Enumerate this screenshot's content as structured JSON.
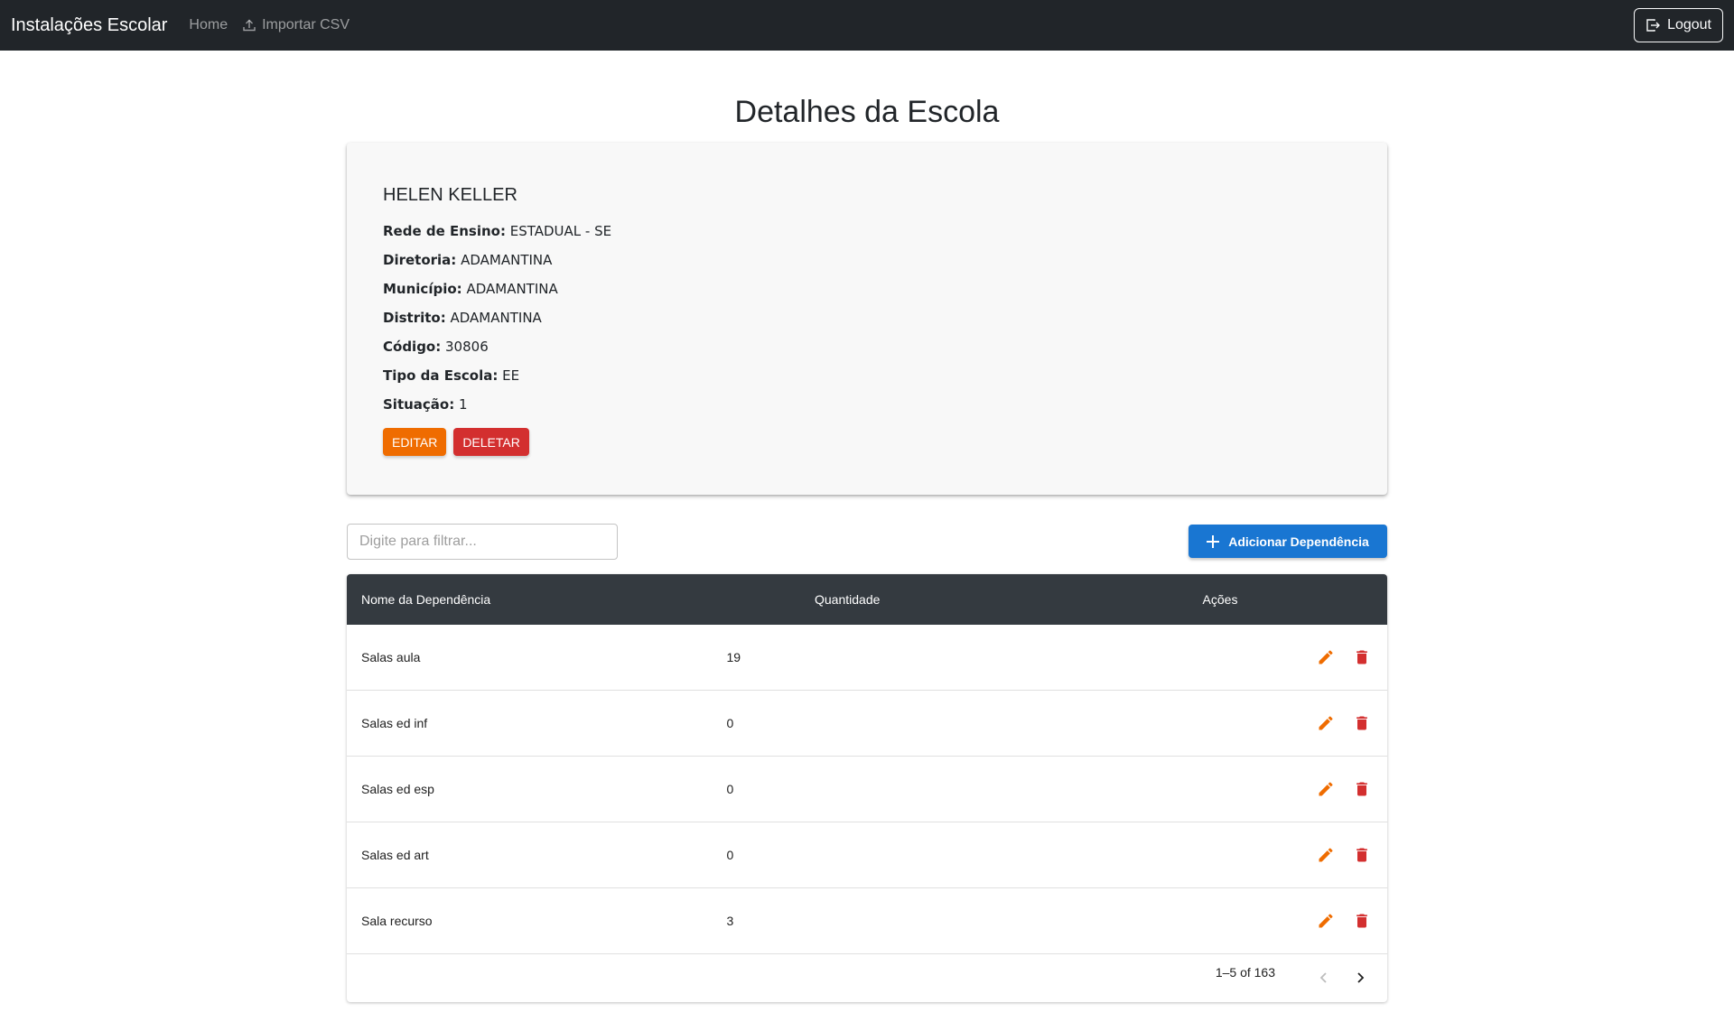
{
  "navbar": {
    "brand": "Instalações Escolar",
    "links": [
      {
        "label": "Home"
      },
      {
        "label": "Importar CSV",
        "icon": "upload-icon"
      }
    ],
    "logout_label": "Logout"
  },
  "page": {
    "title": "Detalhes da Escola"
  },
  "school": {
    "name": "HELEN KELLER",
    "fields": [
      {
        "label": "Rede de Ensino:",
        "value": "ESTADUAL - SE"
      },
      {
        "label": "Diretoria:",
        "value": "ADAMANTINA"
      },
      {
        "label": "Município:",
        "value": "ADAMANTINA"
      },
      {
        "label": "Distrito:",
        "value": "ADAMANTINA"
      },
      {
        "label": "Código:",
        "value": "30806"
      },
      {
        "label": "Tipo da Escola:",
        "value": "EE"
      },
      {
        "label": "Situação:",
        "value": "1"
      }
    ],
    "edit_label": "EDITAR",
    "delete_label": "DELETAR"
  },
  "filter": {
    "placeholder": "Digite para filtrar..."
  },
  "add_button": {
    "label": "Adicionar Dependência"
  },
  "table": {
    "headers": {
      "name": "Nome da Dependência",
      "qty": "Quantidade",
      "actions": "Ações"
    },
    "rows": [
      {
        "name": "Salas aula",
        "qty": "19"
      },
      {
        "name": "Salas ed inf",
        "qty": "0"
      },
      {
        "name": "Salas ed esp",
        "qty": "0"
      },
      {
        "name": "Salas ed art",
        "qty": "0"
      },
      {
        "name": "Sala recurso",
        "qty": "3"
      }
    ],
    "pagination": {
      "range": "1–5 of 163"
    }
  },
  "colors": {
    "navbar": "#212529",
    "edit": "#ef6c00",
    "delete": "#d32f2f",
    "primary": "#1976d2",
    "table_header": "#343a40"
  }
}
